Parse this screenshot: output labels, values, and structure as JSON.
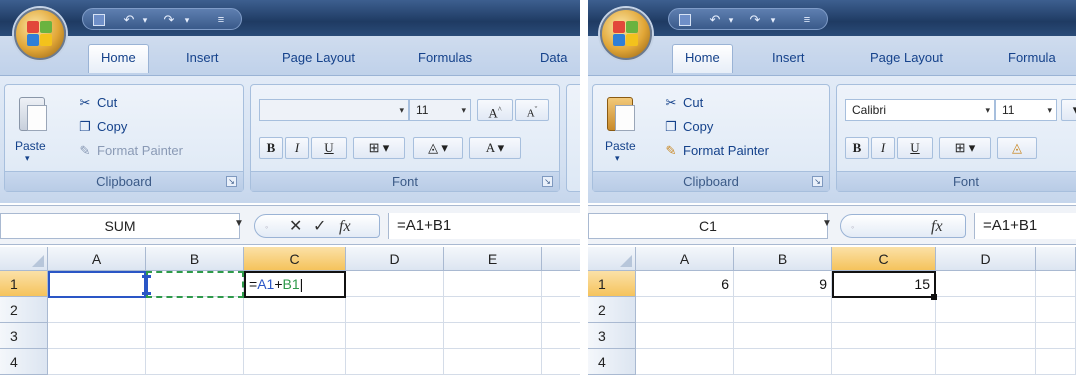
{
  "left": {
    "tabs": [
      "Home",
      "Insert",
      "Page Layout",
      "Formulas",
      "Data"
    ],
    "active_tab": "Home",
    "clipboard": {
      "paste": "Paste",
      "cut": "Cut",
      "copy": "Copy",
      "format_painter": "Format Painter",
      "group_label": "Clipboard"
    },
    "font": {
      "name": "",
      "size": "11",
      "group_label": "Font"
    },
    "name_box": "SUM",
    "formula": "=A1+B1",
    "columns": [
      "A",
      "B",
      "C",
      "D",
      "E"
    ],
    "rows": [
      "1",
      "2",
      "3",
      "4"
    ],
    "cells": {
      "C1_prefix": "=",
      "C1_a1": "A1",
      "C1_plus": "+",
      "C1_b1": "B1"
    }
  },
  "right": {
    "tabs": [
      "Home",
      "Insert",
      "Page Layout",
      "Formula"
    ],
    "active_tab": "Home",
    "clipboard": {
      "paste": "Paste",
      "cut": "Cut",
      "copy": "Copy",
      "format_painter": "Format Painter",
      "group_label": "Clipboard"
    },
    "font": {
      "name": "Calibri",
      "size": "11",
      "group_label": "Font"
    },
    "name_box": "C1",
    "formula": "=A1+B1",
    "columns": [
      "A",
      "B",
      "C",
      "D"
    ],
    "rows": [
      "1",
      "2",
      "3",
      "4"
    ],
    "cells": {
      "A1": "6",
      "B1": "9",
      "C1": "15"
    }
  },
  "icons": {
    "office_button": "office-logo",
    "save": "save-icon",
    "undo": "undo-icon",
    "redo": "redo-icon",
    "customize": "qat-customize-icon",
    "cut": "scissors-icon",
    "copy": "copy-icon",
    "format_painter": "brush-icon",
    "bold": "B",
    "italic": "I",
    "underline": "U",
    "cancel": "✕",
    "enter": "✓",
    "insert_function": "fx"
  },
  "colors": {
    "ref_a1": "#2a56c6",
    "ref_b1": "#2e9a4a",
    "selected_header": "#f5c35c"
  }
}
